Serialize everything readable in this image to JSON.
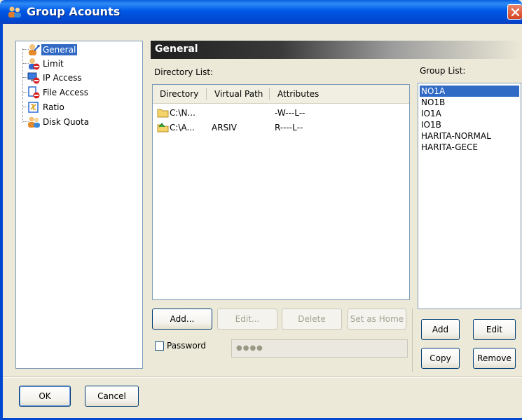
{
  "window": {
    "title": "Group Acounts"
  },
  "tree": {
    "items": [
      {
        "label": "General",
        "icon": "user-key-icon",
        "selected": true
      },
      {
        "label": "Limit",
        "icon": "user-limit-icon"
      },
      {
        "label": "IP Access",
        "icon": "network-access-icon"
      },
      {
        "label": "File Access",
        "icon": "file-access-icon"
      },
      {
        "label": "Ratio",
        "icon": "ratio-icon"
      },
      {
        "label": "Disk Quota",
        "icon": "disk-quota-icon"
      }
    ]
  },
  "general": {
    "header": "General",
    "directory_list_label": "Directory List:",
    "columns": [
      "Directory",
      "Virtual Path",
      "Attributes"
    ],
    "rows": [
      {
        "directory": "C:\\N...",
        "virtual_path": "",
        "attributes": "-W---L--",
        "icon": "folder-icon"
      },
      {
        "directory": "C:\\A...",
        "virtual_path": "ARSIV",
        "attributes": "R----L--",
        "icon": "home-folder-icon"
      }
    ],
    "buttons": {
      "add": "Add...",
      "edit": "Edit...",
      "delete": "Delete",
      "set_home": "Set as Home"
    },
    "password_label": "Password",
    "password_value": "●●●●"
  },
  "group_list": {
    "label": "Group List:",
    "items": [
      "NO1A",
      "NO1B",
      "IO1A",
      "IO1B",
      "HARITA-NORMAL",
      "HARITA-GECE"
    ],
    "selected_index": 0,
    "buttons": {
      "add": "Add",
      "edit": "Edit",
      "copy": "Copy",
      "remove": "Remove"
    }
  },
  "footer": {
    "ok": "OK",
    "cancel": "Cancel"
  },
  "colors": {
    "title_bar": "#0058e6",
    "selection": "#316ac5",
    "dialog_bg": "#ece9d8"
  }
}
